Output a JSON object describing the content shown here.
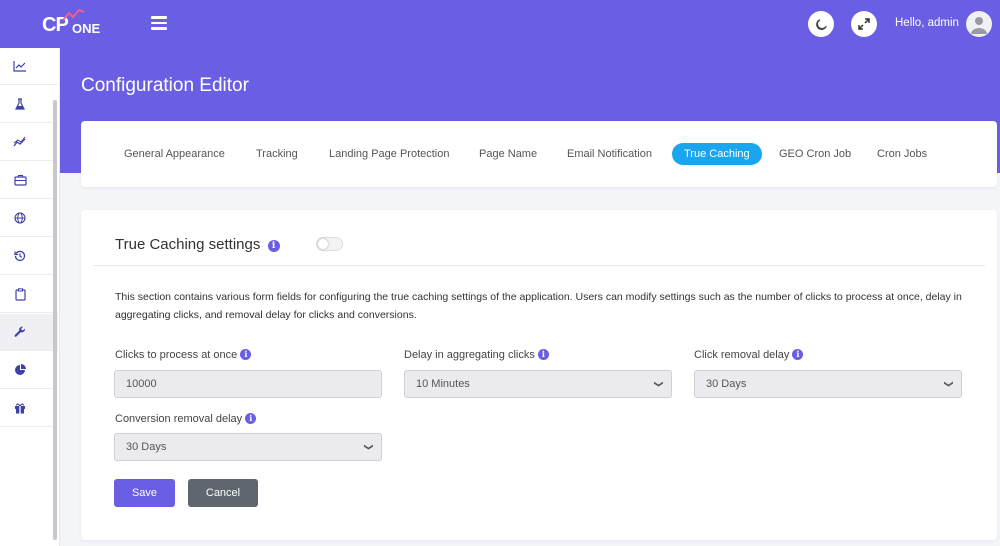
{
  "brand": {
    "logo_main": "CP",
    "logo_sub": "ONE"
  },
  "topbar": {
    "greeting": "Hello, admin"
  },
  "page": {
    "title": "Configuration Editor"
  },
  "sidebar": {
    "items": [
      {
        "icon": "line-chart-icon"
      },
      {
        "icon": "flask-icon"
      },
      {
        "icon": "trend-chart-icon"
      },
      {
        "icon": "briefcase-icon"
      },
      {
        "icon": "globe-icon"
      },
      {
        "icon": "history-icon"
      },
      {
        "icon": "clipboard-icon"
      },
      {
        "icon": "wrench-icon",
        "active": true
      },
      {
        "icon": "pie-chart-icon"
      },
      {
        "icon": "gift-icon"
      }
    ]
  },
  "tabs": [
    {
      "label": "General Appearance"
    },
    {
      "label": "Tracking"
    },
    {
      "label": "Landing Page Protection"
    },
    {
      "label": "Page Name"
    },
    {
      "label": "Email Notification"
    },
    {
      "label": "True Caching",
      "active": true
    },
    {
      "label": "GEO Cron Job"
    },
    {
      "label": "Cron Jobs"
    }
  ],
  "section": {
    "title": "True Caching settings",
    "toggle_on": false,
    "description": "This section contains various form fields for configuring the true caching settings of the application. Users can modify settings such as the number of clicks to process at once, delay in aggregating clicks, and removal delay for clicks and conversions."
  },
  "fields": {
    "clicks_process": {
      "label": "Clicks to process at once",
      "value": "10000"
    },
    "delay_aggregating": {
      "label": "Delay in aggregating clicks",
      "value": "10 Minutes"
    },
    "click_removal": {
      "label": "Click removal delay",
      "value": "30 Days"
    },
    "conversion_removal": {
      "label": "Conversion removal delay",
      "value": "30 Days"
    }
  },
  "buttons": {
    "save": "Save",
    "cancel": "Cancel"
  },
  "colors": {
    "primary": "#6a5fe4",
    "active_tab": "#1aa6ef",
    "cancel": "#5f666d"
  }
}
